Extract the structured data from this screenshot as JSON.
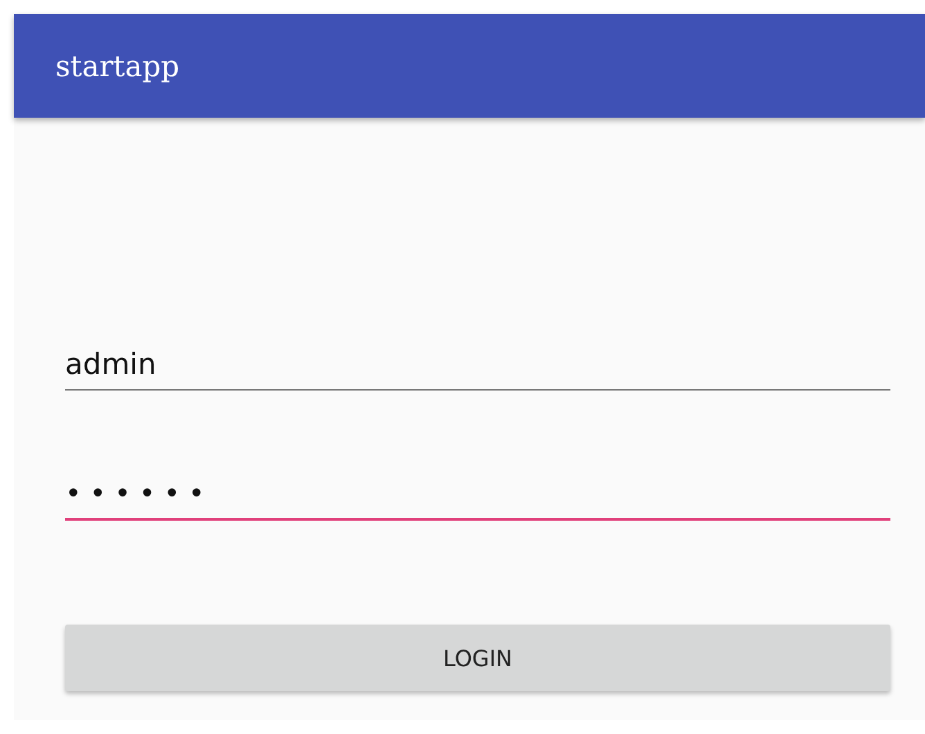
{
  "app_bar": {
    "title": "startapp"
  },
  "fields": [
    {
      "kind": "text",
      "value": "admin",
      "focused": false
    },
    {
      "kind": "password",
      "value": "••••••",
      "focused": true
    }
  ],
  "button": {
    "label": "LOGIN"
  }
}
